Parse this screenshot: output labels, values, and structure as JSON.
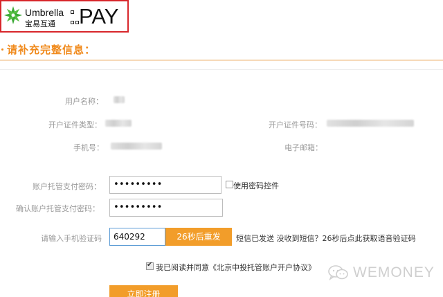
{
  "logo": {
    "brand_en": "Umbrella",
    "brand_cn": "宝易互通",
    "brand_pay": "PAY",
    "border_color": "#d8262b",
    "icon": "green-star-logo-icon"
  },
  "section": {
    "title": "请补充完整信息："
  },
  "info": {
    "username_label": "用户名称：",
    "id_type_label": "开户证件类型：",
    "id_number_label": "开户证件号码：",
    "phone_label": "手机号：",
    "email_label": "电子邮箱："
  },
  "password": {
    "label": "账户托管支付密码：",
    "value": "•••••••••",
    "use_control_label": "使用密码控件",
    "confirm_label": "确认账户托管支付密码：",
    "confirm_value": "•••••••••"
  },
  "sms": {
    "label": "请输入手机验证码",
    "code": "640292",
    "resend_label": "26秒后重发",
    "note": "短信已发送 没收到短信？26秒后点此获取语音验证码"
  },
  "agreement": {
    "text": "我已阅读并同意《北京中投托管账户开户协议》"
  },
  "register_button": "立即注册",
  "watermark": {
    "text": "WEMONEY",
    "icon": "wechat-icon"
  },
  "colors": {
    "accent": "#f08a1c",
    "button": "#f29d2a",
    "logo_border": "#d8262b"
  }
}
